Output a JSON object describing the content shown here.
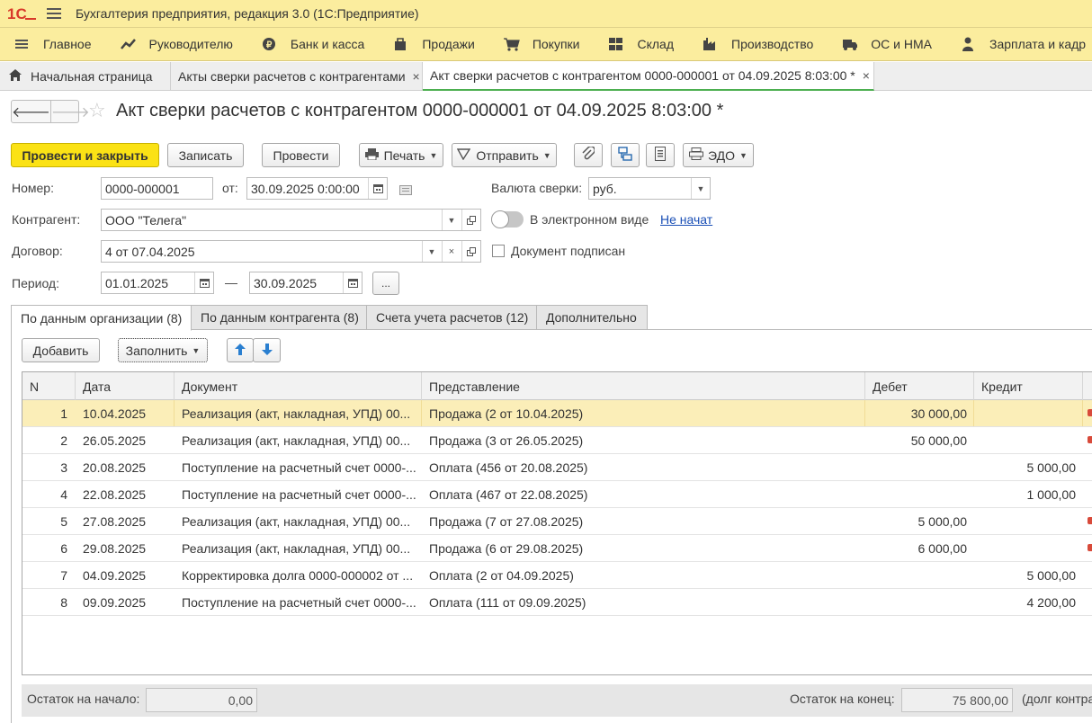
{
  "app": {
    "title": "Бухгалтерия предприятия, редакция 3.0  (1С:Предприятие)",
    "logo_text": "1С"
  },
  "sections": [
    {
      "label": "Главное",
      "icon": "menu-icon"
    },
    {
      "label": "Руководителю",
      "icon": "chart-trend-icon"
    },
    {
      "label": "Банк и касса",
      "icon": "bank-coin-icon"
    },
    {
      "label": "Продажи",
      "icon": "shopping-bag-icon"
    },
    {
      "label": "Покупки",
      "icon": "cart-icon"
    },
    {
      "label": "Склад",
      "icon": "warehouse-boxes-icon"
    },
    {
      "label": "Производство",
      "icon": "factory-icon"
    },
    {
      "label": "ОС и НМА",
      "icon": "truck-icon"
    },
    {
      "label": "Зарплата и кадр",
      "icon": "person-icon"
    }
  ],
  "open_tabs": [
    {
      "label": "Начальная страница",
      "icon": "home-icon"
    },
    {
      "label": "Акты сверки расчетов с контрагентами",
      "close": "×"
    },
    {
      "label": "Акт сверки расчетов с контрагентом 0000-000001 от 04.09.2025 8:03:00 *",
      "close": "×"
    }
  ],
  "header": {
    "back": "🡐",
    "forward": "🡒",
    "star": "☆",
    "title": "Акт сверки расчетов с контрагентом 0000-000001 от 04.09.2025 8:03:00 *"
  },
  "toolbar": {
    "post_close": "Провести и закрыть",
    "save": "Записать",
    "post": "Провести",
    "print": "Печать",
    "send": "Отправить",
    "edo": "ЭДО"
  },
  "form": {
    "number_label": "Номер:",
    "number": "0000-000001",
    "from_label": "от:",
    "date": "30.09.2025  0:00:00",
    "currency_label": "Валюта сверки:",
    "currency": "руб.",
    "counterparty_label": "Контрагент:",
    "counterparty": "ООО \"Телега\"",
    "electronic_label": "В электронном виде",
    "electronic_status": "Не начат",
    "contract_label": "Договор:",
    "contract": "4 от 07.04.2025",
    "signed_label": "Документ подписан",
    "period_label": "Период:",
    "period_from": "01.01.2025",
    "period_dash": "—",
    "period_to": "30.09.2025",
    "period_more": "..."
  },
  "form_tabs": [
    "По данным организации (8)",
    "По данным контрагента (8)",
    "Счета учета расчетов (12)",
    "Дополнительно"
  ],
  "table_toolbar": {
    "add": "Добавить",
    "fill": "Заполнить"
  },
  "table": {
    "columns": [
      "N",
      "Дата",
      "Документ",
      "Представление",
      "Дебет",
      "Кредит"
    ],
    "rows": [
      {
        "n": "1",
        "date": "10.04.2025",
        "doc": "Реализация (акт, накладная, УПД) 00...",
        "repr": "Продажа (2 от 10.04.2025)",
        "debit": "30 000,00",
        "credit": "",
        "mark": true
      },
      {
        "n": "2",
        "date": "26.05.2025",
        "doc": "Реализация (акт, накладная, УПД) 00...",
        "repr": "Продажа (3 от 26.05.2025)",
        "debit": "50 000,00",
        "credit": "",
        "mark": true
      },
      {
        "n": "3",
        "date": "20.08.2025",
        "doc": "Поступление на расчетный счет 0000-...",
        "repr": "Оплата (456 от 20.08.2025)",
        "debit": "",
        "credit": "5 000,00",
        "mark": false
      },
      {
        "n": "4",
        "date": "22.08.2025",
        "doc": "Поступление на расчетный счет 0000-...",
        "repr": "Оплата (467 от 22.08.2025)",
        "debit": "",
        "credit": "1 000,00",
        "mark": false
      },
      {
        "n": "5",
        "date": "27.08.2025",
        "doc": "Реализация (акт, накладная, УПД) 00...",
        "repr": "Продажа (7 от 27.08.2025)",
        "debit": "5 000,00",
        "credit": "",
        "mark": true
      },
      {
        "n": "6",
        "date": "29.08.2025",
        "doc": "Реализация (акт, накладная, УПД) 00...",
        "repr": "Продажа (6 от 29.08.2025)",
        "debit": "6 000,00",
        "credit": "",
        "mark": true
      },
      {
        "n": "7",
        "date": "04.09.2025",
        "doc": "Корректировка долга 0000-000002 от ...",
        "repr": "Оплата (2 от 04.09.2025)",
        "debit": "",
        "credit": "5 000,00",
        "mark": false
      },
      {
        "n": "8",
        "date": "09.09.2025",
        "doc": "Поступление на расчетный счет 0000-...",
        "repr": "Оплата (111 от 09.09.2025)",
        "debit": "",
        "credit": "4 200,00",
        "mark": false
      }
    ]
  },
  "footer": {
    "start_label": "Остаток на начало:",
    "start_value": "0,00",
    "end_label": "Остаток на конец:",
    "end_value": "75 800,00",
    "end_note": "(долг контра"
  },
  "colors": {
    "titlebar_bg": "#fbed9e",
    "primary_button": "#fbe215",
    "selected_row": "#fbeeb8",
    "link": "#1a4fb6",
    "logo_red": "#d83a2a"
  }
}
